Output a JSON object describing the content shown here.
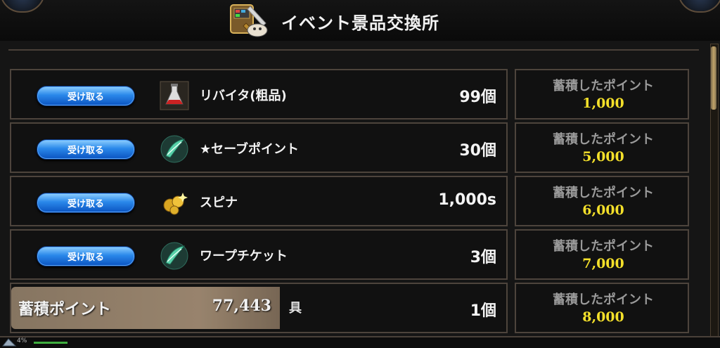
{
  "header": {
    "title": "イベント景品交換所",
    "icon": "shop-sword-chest-icon"
  },
  "rows": [
    {
      "button_label": "受け取る",
      "icon": "potion-flask-icon",
      "name": "リバイタ(粗品)",
      "quantity": "99個",
      "points_label": "蓄積したポイント",
      "points_value": "1,000"
    },
    {
      "button_label": "受け取る",
      "icon": "green-feather-crystal-icon",
      "name": "★セーブポイント",
      "quantity": "30個",
      "points_label": "蓄積したポイント",
      "points_value": "5,000"
    },
    {
      "button_label": "受け取る",
      "icon": "gold-coins-icon",
      "name": "スピナ",
      "quantity": "1,000s",
      "points_label": "蓄積したポイント",
      "points_value": "6,000"
    },
    {
      "button_label": "受け取る",
      "icon": "green-feather-crystal-icon",
      "name": "ワープチケット",
      "quantity": "3個",
      "points_label": "蓄積したポイント",
      "points_value": "7,000"
    },
    {
      "name_suffix": "具",
      "quantity": "1個",
      "points_label": "蓄積したポイント",
      "points_value": "8,000"
    }
  ],
  "total": {
    "label": "蓄積ポイント",
    "value": "77,443"
  },
  "footer": {
    "mini_text": "4%"
  },
  "colors": {
    "button_blue": "#2a88ea",
    "points_yellow": "#f4e02a",
    "frame_brown": "#4d443c"
  }
}
